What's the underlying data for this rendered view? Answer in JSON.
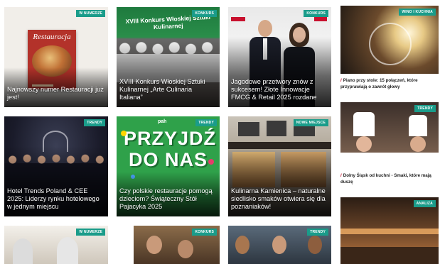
{
  "colors": {
    "badge": "#1a9c8a",
    "accent_red": "#c8102e",
    "text": "#222222"
  },
  "grid": [
    {
      "badge": "W NUMERZE",
      "title": "Najnowszy numer Restauracji już jest!",
      "magazine_name": "Restauracja"
    },
    {
      "badge": "KONKURS",
      "title": "XVIII Konkurs Włoskiej Sztuki Kulinarnej „Arte Culinaria Italiana”",
      "banner": "XVIII Konkurs Włoskiej Sztuki Kulinarnej"
    },
    {
      "badge": "KONKURS",
      "title": "Jagodowe przetwory znów z sukcesem! Złote Innowacje FMCG & Retail 2025 rozdane"
    },
    {
      "badge": "TRENDY",
      "title": "Hotel Trends Poland & CEE 2025: Liderzy rynku hotelowego w jednym miejscu"
    },
    {
      "badge": "TRENDY",
      "title": "Czy polskie restauracje pomogą dzieciom? Świąteczny Stół Pajacyka 2025",
      "logo": "pah",
      "poster_text": "PRZYJDŹ DO NAS"
    },
    {
      "badge": "NOWE MIEJSCE",
      "title": "Kulinarna Kamienica – naturalne siedlisko smaków otwiera się dla poznaniaków!"
    },
    {
      "badge": "W NUMERZE",
      "title": ""
    },
    {
      "badge": "KONKURS",
      "title": ""
    },
    {
      "badge": "TRENDY",
      "title": ""
    }
  ],
  "sidebar": [
    {
      "badge": "WINO I KUCHNIA",
      "text": "Piano przy stole: 15 połączeń, które przyprawiają o zawrót głowy"
    },
    {
      "badge": "TRENDY",
      "text": "Dolny Śląsk od kuchni - Smaki, które mają duszę"
    },
    {
      "badge": "ANALIZA",
      "text": ""
    }
  ]
}
